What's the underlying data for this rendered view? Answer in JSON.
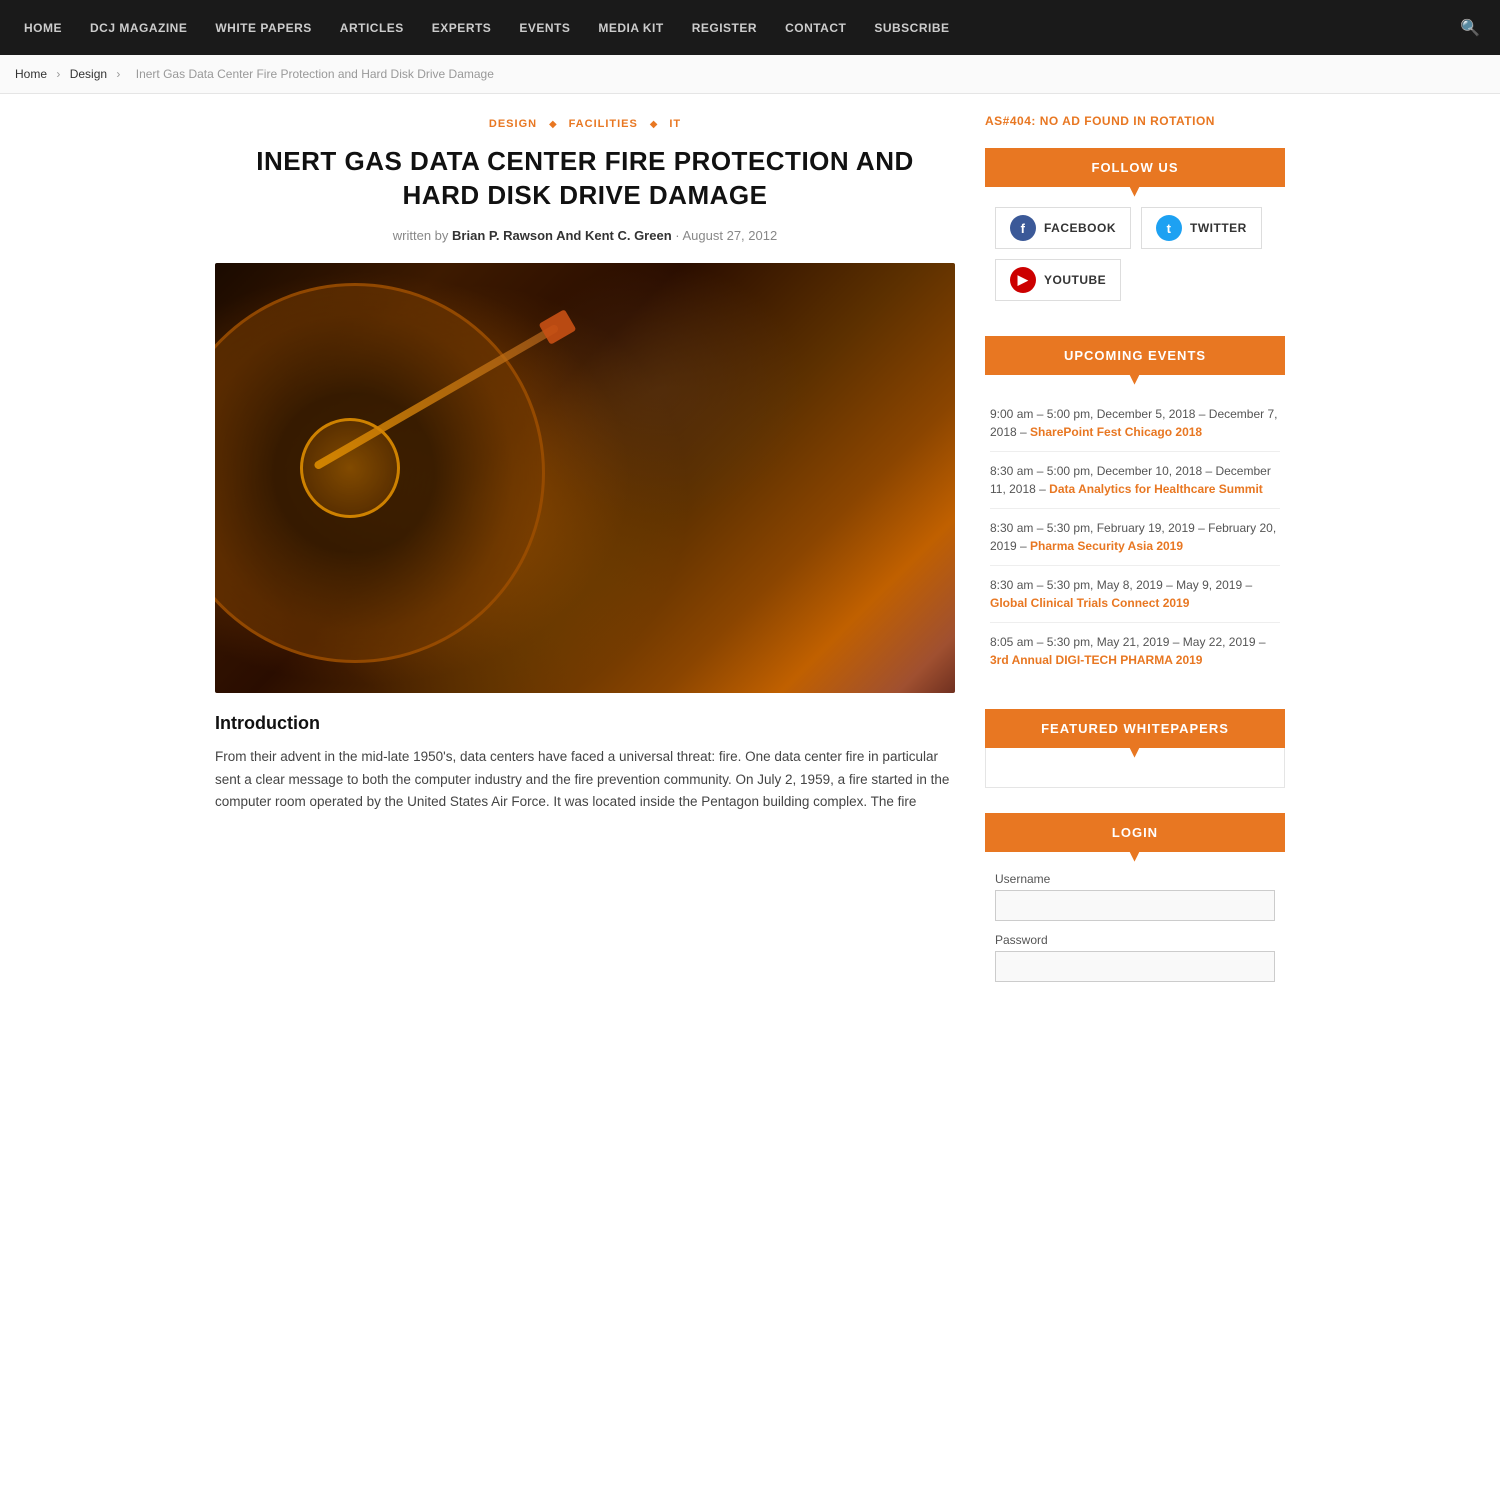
{
  "nav": {
    "items": [
      {
        "label": "HOME",
        "href": "#"
      },
      {
        "label": "DCJ MAGAZINE",
        "href": "#"
      },
      {
        "label": "WHITE PAPERS",
        "href": "#"
      },
      {
        "label": "ARTICLES",
        "href": "#"
      },
      {
        "label": "EXPERTS",
        "href": "#"
      },
      {
        "label": "EVENTS",
        "href": "#"
      },
      {
        "label": "MEDIA KIT",
        "href": "#"
      },
      {
        "label": "REGISTER",
        "href": "#"
      },
      {
        "label": "CONTACT",
        "href": "#"
      },
      {
        "label": "SUBSCRIBE",
        "href": "#"
      }
    ]
  },
  "breadcrumb": {
    "home": "Home",
    "section": "Design",
    "current": "Inert Gas Data Center Fire Protection and Hard Disk Drive Damage"
  },
  "article": {
    "categories": [
      "DESIGN",
      "FACILITIES",
      "IT"
    ],
    "title": "INERT GAS DATA CENTER FIRE PROTECTION AND HARD DISK DRIVE DAMAGE",
    "written_by_label": "written by",
    "author": "Brian P. Rawson And Kent C. Green",
    "date": "August 27, 2012",
    "intro_heading": "Introduction",
    "intro_text": "From their advent in the mid-late 1950's, data centers have faced a universal threat: fire. One data center fire in particular sent a clear message to both the computer industry and the fire prevention community. On July 2, 1959, a fire started in the computer room operated by the United States Air Force. It was located inside the Pentagon building complex. The fire"
  },
  "sidebar": {
    "ad_text": "AS#404: NO AD FOUND IN ROTATION",
    "follow_us": {
      "header": "FOLLOW US",
      "facebook": "FACEBOOK",
      "twitter": "TWITTER",
      "youtube": "YOUTUBE"
    },
    "upcoming_events": {
      "header": "UPCOMING EVENTS",
      "events": [
        {
          "time": "9:00 am – 5:00 pm, December 5, 2018 – December 7, 2018 – ",
          "link_text": "SharePoint Fest Chicago 2018",
          "link": "#"
        },
        {
          "time": "8:30 am – 5:00 pm, December 10, 2018 – December 11, 2018 – ",
          "link_text": "Data Analytics for Healthcare Summit",
          "link": "#"
        },
        {
          "time": "8:30 am – 5:30 pm, February 19, 2019 – February 20, 2019 – ",
          "link_text": "Pharma Security Asia 2019",
          "link": "#"
        },
        {
          "time": "8:30 am – 5:30 pm, May 8, 2019 – May 9, 2019 – ",
          "link_text": "Global Clinical Trials Connect 2019",
          "link": "#"
        },
        {
          "time": "8:05 am – 5:30 pm, May 21, 2019 – May 22, 2019 – ",
          "link_text": "3rd Annual DIGI-TECH PHARMA 2019",
          "link": "#"
        }
      ]
    },
    "featured_whitepapers": {
      "header": "FEATURED WHITEPAPERS"
    },
    "login": {
      "header": "LOGIN",
      "username_label": "Username",
      "password_label": "Password"
    }
  }
}
